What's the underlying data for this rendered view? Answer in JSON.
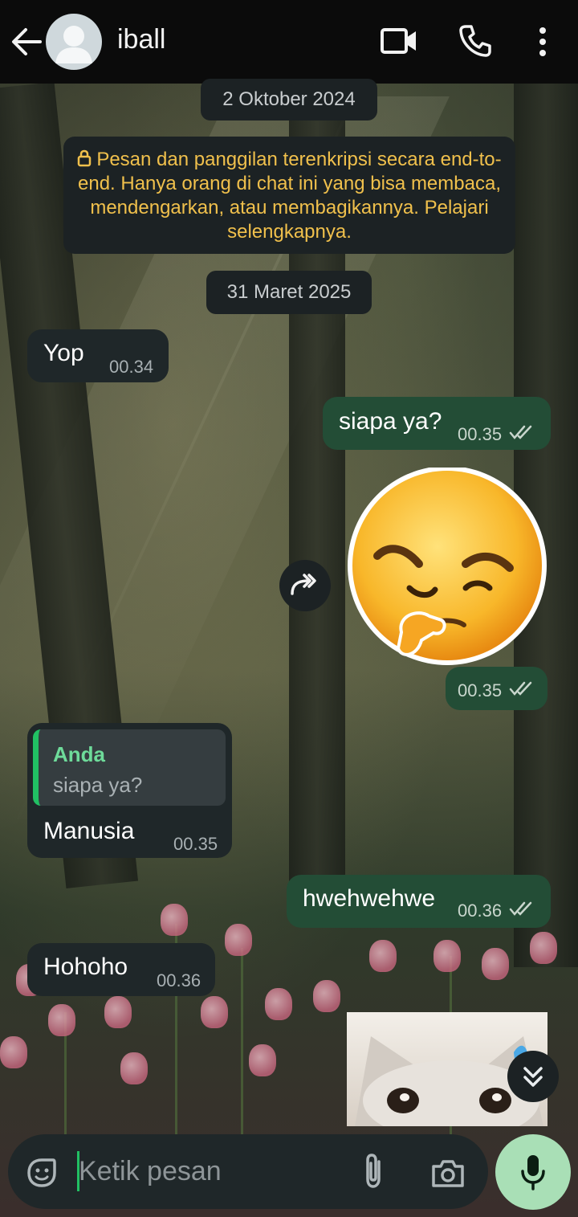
{
  "header": {
    "contact_name": "iball"
  },
  "chat": {
    "date_1": "2 Oktober 2024",
    "encryption_notice": "Pesan dan panggilan terenkripsi secara end-to-end. Hanya orang di chat ini yang bisa membaca, mendengarkan, atau membagikannya. Pelajari selengkapnya.",
    "date_2": "31 Maret 2025",
    "messages": [
      {
        "direction": "in",
        "text": "Yop",
        "time": "00.34"
      },
      {
        "direction": "out",
        "text": "siapa ya?",
        "time": "00.35",
        "status": "read"
      },
      {
        "direction": "out",
        "type": "sticker",
        "sticker": "thinking-smirk-emoji",
        "time": "00.35",
        "status": "read"
      },
      {
        "direction": "in",
        "reply_to": {
          "author": "Anda",
          "text": "siapa ya?"
        },
        "text": "Manusia",
        "time": "00.35"
      },
      {
        "direction": "out",
        "text": "hwehwehwe",
        "time": "00.36",
        "status": "read"
      },
      {
        "direction": "in",
        "text": "Hohoho",
        "time": "00.36"
      }
    ]
  },
  "composer": {
    "placeholder": "Ketik pesan"
  },
  "colors": {
    "header_bg": "#0b0b0b",
    "incoming_bubble": "#1f2729",
    "outgoing_bubble": "#234d36",
    "accent_green": "#21c063",
    "encryption_text": "#f0c04c",
    "mic_button": "#a9dfb6"
  },
  "icons": {
    "back": "arrow-left-icon",
    "video": "video-camera-icon",
    "call": "phone-icon",
    "more": "more-vert-icon",
    "forward": "forward-icon",
    "scroll_down": "double-chevron-down-icon",
    "sticker": "sticker-icon",
    "attach": "paperclip-icon",
    "camera": "camera-icon",
    "mic": "microphone-icon"
  }
}
